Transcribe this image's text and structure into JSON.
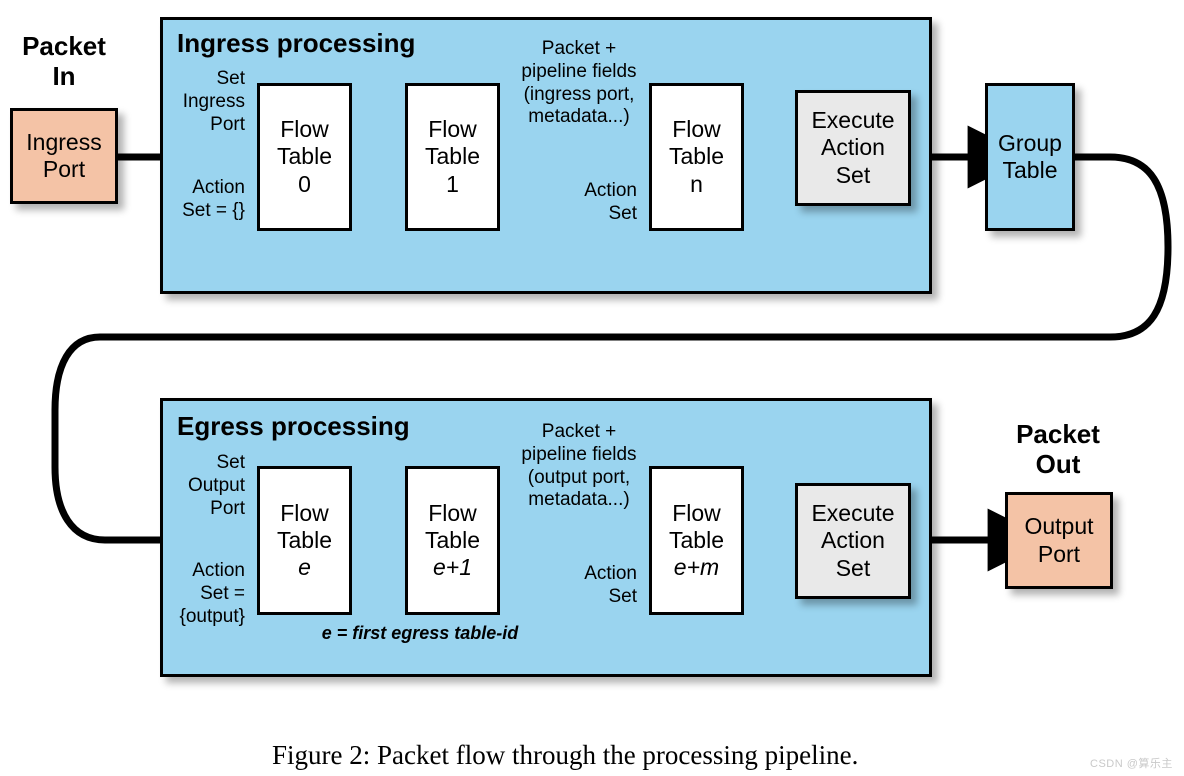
{
  "figure": {
    "caption": "Figure 2: Packet flow through the processing pipeline.",
    "watermark": "CSDN @算乐主"
  },
  "packet_in": {
    "header": "Packet\nIn",
    "port_label": "Ingress\nPort"
  },
  "packet_out": {
    "header": "Packet\nOut",
    "port_label": "Output\nPort"
  },
  "ingress": {
    "title": "Ingress processing",
    "set_port_note": "Set\nIngress\nPort",
    "action_set_note": "Action\nSet = {}",
    "pipeline_note": "Packet +\npipeline fields\n(ingress port,\nmetadata...)",
    "mid_action_note": "Action\nSet",
    "tables": [
      {
        "line1": "Flow",
        "line2": "Table",
        "line3": "0",
        "italic3": false
      },
      {
        "line1": "Flow",
        "line2": "Table",
        "line3": "1",
        "italic3": false
      },
      {
        "line1": "Flow",
        "line2": "Table",
        "line3": "n",
        "italic3": false
      }
    ],
    "execute": "Execute\nAction\nSet"
  },
  "group_table": {
    "label": "Group\nTable"
  },
  "egress": {
    "title": "Egress processing",
    "set_port_note": "Set\nOutput\nPort",
    "action_set_note": "Action\nSet =\n{output}",
    "pipeline_note": "Packet +\npipeline fields\n(output port,\nmetadata...)",
    "mid_action_note": "Action\nSet",
    "footnote": "e = first egress table-id",
    "tables": [
      {
        "line1": "Flow",
        "line2": "Table",
        "line3": "e",
        "italic3": true
      },
      {
        "line1": "Flow",
        "line2": "Table",
        "line3": "e+1",
        "italic3": true
      },
      {
        "line1": "Flow",
        "line2": "Table",
        "line3": "e+m",
        "italic3": true
      }
    ],
    "execute": "Execute\nAction\nSet"
  },
  "colors": {
    "panel_blue": "#9ad4ef",
    "port_salmon": "#f4c3a6",
    "execute_gray": "#e9e9e9",
    "table_white": "#ffffff",
    "stroke_black": "#000000"
  }
}
